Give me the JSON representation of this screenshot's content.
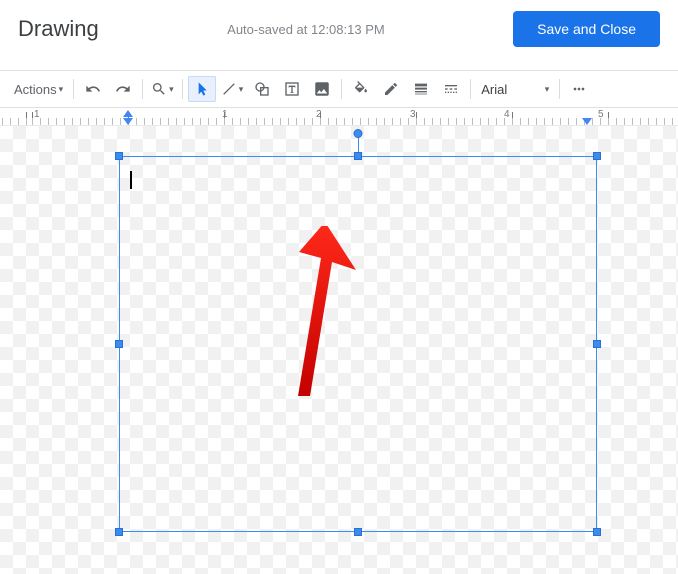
{
  "header": {
    "title": "Drawing",
    "autosave_text": "Auto-saved at 12:08:13 PM",
    "save_button_label": "Save and Close"
  },
  "toolbar": {
    "actions_label": "Actions",
    "font_name": "Arial"
  },
  "ruler": {
    "numbers": [
      "1",
      "1",
      "2",
      "3",
      "4",
      "5"
    ]
  }
}
